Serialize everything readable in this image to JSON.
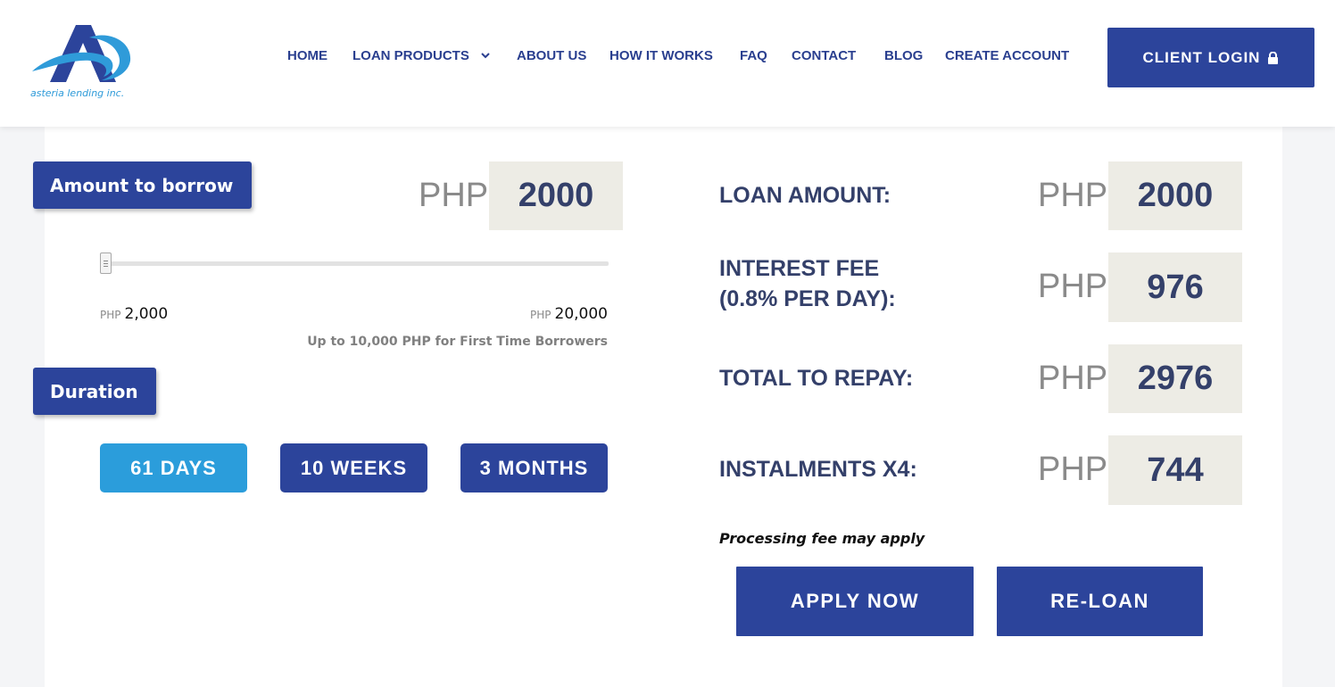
{
  "brand": {
    "logo_text": "asteria lending inc."
  },
  "nav": {
    "items": [
      "HOME",
      "LOAN PRODUCTS",
      "ABOUT US",
      "HOW IT WORKS",
      "FAQ",
      "CONTACT",
      "BLOG",
      "CREATE ACCOUNT"
    ],
    "login_label": "CLIENT LOGIN"
  },
  "calculator": {
    "amount_tag": "Amount to borrow",
    "currency": "PHP",
    "amount_value": "2000",
    "slider": {
      "min_currency": "PHP",
      "min_value": "2,000",
      "max_currency": "PHP",
      "max_value": "20,000",
      "level": 0
    },
    "first_time_note": "Up to 10,000 PHP for First Time Borrowers",
    "duration_tag": "Duration",
    "durations": [
      {
        "label": "61 DAYS",
        "selected": true
      },
      {
        "label": "10 WEEKS",
        "selected": false
      },
      {
        "label": "3 MONTHS",
        "selected": false
      }
    ]
  },
  "summary": {
    "loan_amount_label": "LOAN AMOUNT:",
    "loan_amount_value": "2000",
    "interest_label_line1": "INTEREST FEE",
    "interest_label_line2": "(0.8% PER DAY):",
    "interest_value": "976",
    "total_label": "TOTAL TO REPAY:",
    "total_value": "2976",
    "instalments_label": "INSTALMENTS X4:",
    "instalments_value": "744",
    "currency": "PHP",
    "processing_note": "Processing fee may apply",
    "apply_label": "APPLY NOW",
    "reloan_label": "RE-LOAN"
  },
  "colors": {
    "primary": "#2c449b",
    "selected_duration": "#2b9ddb",
    "value_box": "#edece5",
    "value_text": "#34406a"
  }
}
